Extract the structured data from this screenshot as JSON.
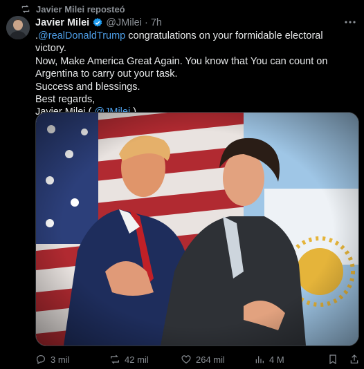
{
  "repost": {
    "icon": "repost-icon",
    "text": "Javier Milei reposteó"
  },
  "tweet": {
    "avatar_icon": "avatar",
    "author_name": "Javier Milei",
    "verified_icon": "verified-badge-icon",
    "handle": "@JMilei",
    "separator": "·",
    "time": "7h",
    "more_icon": "more-options-icon",
    "lines": {
      "l1_prefix": ".",
      "l1_mention": "@realDonaldTrump",
      "l1_rest": " congratulations on your formidable electoral victory.",
      "l2": "Now, Make America Great Again. You know that You can count on",
      "l3": "Argentina to carry out your task.",
      "l4": "Success and blessings.",
      "l5": "Best regards,",
      "l6_prefix": "Javier Milei ( ",
      "l6_mention": "@JMilei",
      "l6_suffix": " )"
    }
  },
  "media": {
    "description_icon": "photo-trump-milei-embrace-with-us-and-argentina-flags"
  },
  "actions": {
    "replies": "3 mil",
    "reposts": "42 mil",
    "likes": "264 mil",
    "views": "4 M",
    "reply_icon": "reply-icon",
    "repost_icon": "repost-icon",
    "like_icon": "heart-icon",
    "views_icon": "views-chart-icon",
    "bookmark_icon": "bookmark-icon",
    "share_icon": "share-icon"
  },
  "colors": {
    "background": "#000000",
    "text": "#e7e9ea",
    "muted": "#8b9096",
    "link": "#4e9fe8",
    "verified": "#1d9bf0"
  }
}
